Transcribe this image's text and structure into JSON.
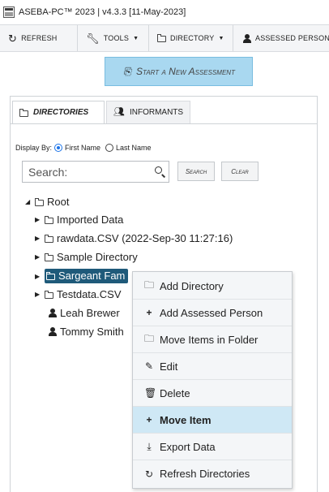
{
  "app": {
    "title": "ASEBA-PC™ 2023 | v4.3.3  [11-May-2023]"
  },
  "toolbar": {
    "refresh": "REFRESH",
    "tools": "TOOLS",
    "directory": "DIRECTORY",
    "assessed_person": "ASSESSED PERSON"
  },
  "start_assessment": "Start a New Assessment",
  "tabs": [
    {
      "label": "DIRECTORIES",
      "active": true
    },
    {
      "label": "INFORMANTS",
      "active": false
    }
  ],
  "display_by": {
    "label": "Display By:",
    "options": [
      "First Name",
      "Last Name"
    ],
    "selected": "First Name"
  },
  "search": {
    "placeholder": "Search:",
    "search_button": "Search",
    "clear_button": "Clear"
  },
  "tree": {
    "root": "Root",
    "folders": [
      "Imported Data",
      "rawdata.CSV (2022-Sep-30 11:27:16)",
      "Sample Directory",
      "Sargeant Fam",
      "Testdata.CSV"
    ],
    "selected": "Sargeant Fam",
    "persons": [
      "Leah Brewer",
      "Tommy Smith"
    ]
  },
  "context_menu": {
    "items": [
      {
        "label": "Add Directory",
        "icon": "folder-add-icon"
      },
      {
        "label": "Add Assessed Person",
        "icon": "plus-icon"
      },
      {
        "label": "Move Items in Folder",
        "icon": "folder-move-icon"
      },
      {
        "label": "Edit",
        "icon": "pencil-icon"
      },
      {
        "label": "Delete",
        "icon": "trash-icon"
      },
      {
        "label": "Move Item",
        "icon": "plus-icon",
        "highlighted": true
      },
      {
        "label": "Export Data",
        "icon": "download-icon"
      },
      {
        "label": "Refresh Directories",
        "icon": "refresh-icon"
      }
    ]
  }
}
